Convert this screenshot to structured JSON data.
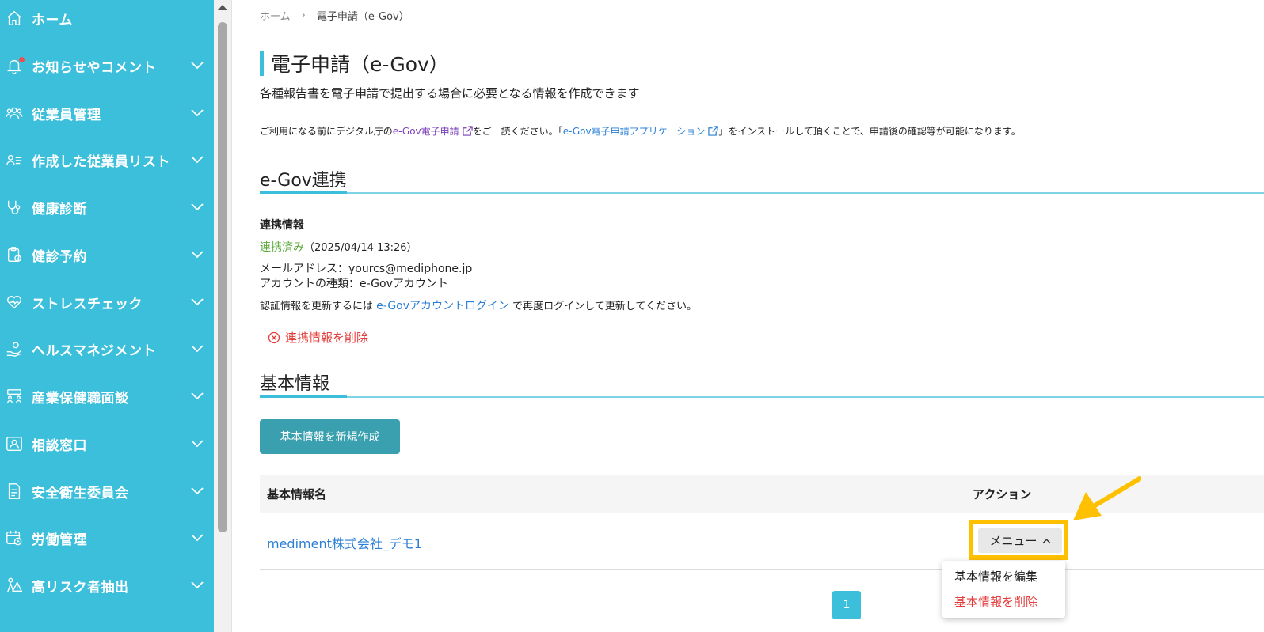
{
  "sidebar": {
    "items": [
      {
        "label": "ホーム",
        "icon": "home-icon",
        "has_chevron": false
      },
      {
        "label": "お知らせやコメント",
        "icon": "bell-icon",
        "has_chevron": true
      },
      {
        "label": "従業員管理",
        "icon": "users-icon",
        "has_chevron": true
      },
      {
        "label": "作成した従業員リスト",
        "icon": "user-list-icon",
        "has_chevron": true
      },
      {
        "label": "健康診断",
        "icon": "stethoscope-icon",
        "has_chevron": true
      },
      {
        "label": "健診予約",
        "icon": "clipboard-icon",
        "has_chevron": true
      },
      {
        "label": "ストレスチェック",
        "icon": "heart-icon",
        "has_chevron": true
      },
      {
        "label": "ヘルスマネジメント",
        "icon": "health-hand-icon",
        "has_chevron": true
      },
      {
        "label": "産業保健職面談",
        "icon": "interview-icon",
        "has_chevron": true
      },
      {
        "label": "相談窓口",
        "icon": "consult-icon",
        "has_chevron": true
      },
      {
        "label": "安全衛生委員会",
        "icon": "document-icon",
        "has_chevron": true
      },
      {
        "label": "労働管理",
        "icon": "calendar-clock-icon",
        "has_chevron": true
      },
      {
        "label": "高リスク者抽出",
        "icon": "warning-person-icon",
        "has_chevron": true
      }
    ]
  },
  "breadcrumb": {
    "home": "ホーム",
    "separator": "›",
    "current": "電子申請（e-Gov）"
  },
  "page": {
    "title": "電子申請（e-Gov）",
    "description": "各種報告書を電子申請で提出する場合に必要となる情報を作成できます",
    "notice": {
      "part1": "ご利用になる前にデジタル庁の",
      "link1": "e-Gov電子申請",
      "part2": "をご一読ください。「",
      "link2": "e-Gov電子申請アプリケーション",
      "part3": "」をインストールして頂くことで、申請後の確認等が可能になります。"
    }
  },
  "egov": {
    "section_title": "e-Gov連携",
    "info_label": "連携情報",
    "status": "連携済み",
    "status_date": "（2025/04/14 13:26）",
    "email": "メールアドレス：yourcs@mediphone.jp",
    "account_type": "アカウントの種類：e-Govアカウント",
    "update_prefix": "認証情報を更新するには ",
    "update_link": "e-Govアカウントログイン",
    "update_suffix": " で再度ログインして更新してください。",
    "delete_label": "連携情報を削除"
  },
  "basic": {
    "section_title": "基本情報",
    "create_button": "基本情報を新規作成",
    "columns": [
      "基本情報名",
      "アクション"
    ],
    "rows": [
      {
        "name": "mediment株式会社_デモ1",
        "action": "メニュー"
      }
    ],
    "dropdown": {
      "edit": "基本情報を編集",
      "delete": "基本情報を削除"
    }
  },
  "pagination": {
    "current": "1"
  },
  "colors": {
    "accent": "#3bbfdb",
    "button": "#3a9fae",
    "highlight": "#ffc000",
    "danger": "#e53c3c",
    "link": "#2a7fd4",
    "success": "#5aa83a"
  }
}
